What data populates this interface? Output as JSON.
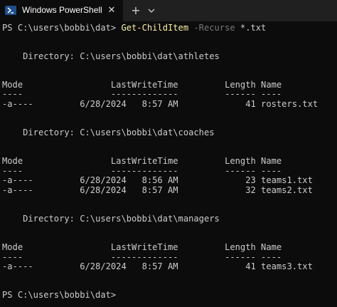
{
  "window": {
    "tab_title": "Windows PowerShell",
    "close_symbol": "✕",
    "new_tab_symbol": "+",
    "icon": "powershell-icon",
    "dropdown_icon": "chevron-down-icon"
  },
  "terminal": {
    "command_prompt": "PS C:\\users\\bobbi\\dat> ",
    "command_name": "Get-ChildItem",
    "command_param": " -Recurse",
    "command_arg": " *.txt",
    "final_prompt": "PS C:\\users\\bobbi\\dat>",
    "sections": [
      {
        "directory": "    Directory: C:\\users\\bobbi\\dat\\athletes",
        "header": "Mode                 LastWriteTime         Length Name",
        "underline": "----                 -------------         ------ ----",
        "rows": [
          "-a----         6/28/2024   8:57 AM             41 rosters.txt"
        ]
      },
      {
        "directory": "    Directory: C:\\users\\bobbi\\dat\\coaches",
        "header": "Mode                 LastWriteTime         Length Name",
        "underline": "----                 -------------         ------ ----",
        "rows": [
          "-a----         6/28/2024   8:56 AM             23 teams1.txt",
          "-a----         6/28/2024   8:57 AM             32 teams2.txt"
        ]
      },
      {
        "directory": "    Directory: C:\\users\\bobbi\\dat\\managers",
        "header": "Mode                 LastWriteTime         Length Name",
        "underline": "----                 -------------         ------ ----",
        "rows": [
          "-a----         6/28/2024   8:57 AM             41 teams3.txt"
        ]
      }
    ]
  },
  "colors": {
    "background": "#0c0c0c",
    "titlebar": "#202020",
    "text": "#cccccc",
    "command": "#f9f1a5",
    "parameter": "#767676"
  }
}
